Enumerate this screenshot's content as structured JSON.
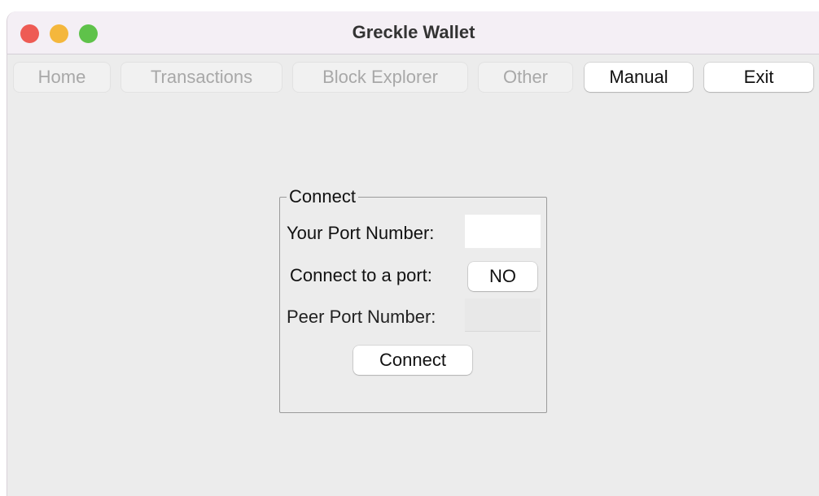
{
  "window": {
    "title": "Greckle Wallet",
    "controls": {
      "close_color": "#ee5b54",
      "minimize_color": "#f4b73c",
      "zoom_color": "#5fc24a"
    }
  },
  "nav": {
    "home": "Home",
    "transactions": "Transactions",
    "block_explorer": "Block Explorer",
    "other": "Other",
    "manual": "Manual",
    "exit": "Exit"
  },
  "connect_panel": {
    "legend": "Connect",
    "your_port_label": "Your Port Number:",
    "your_port_value": "",
    "connect_to_port_label": "Connect to a port:",
    "connect_to_port_value": "NO",
    "peer_port_label": "Peer Port Number:",
    "peer_port_value": "",
    "connect_button": "Connect"
  }
}
